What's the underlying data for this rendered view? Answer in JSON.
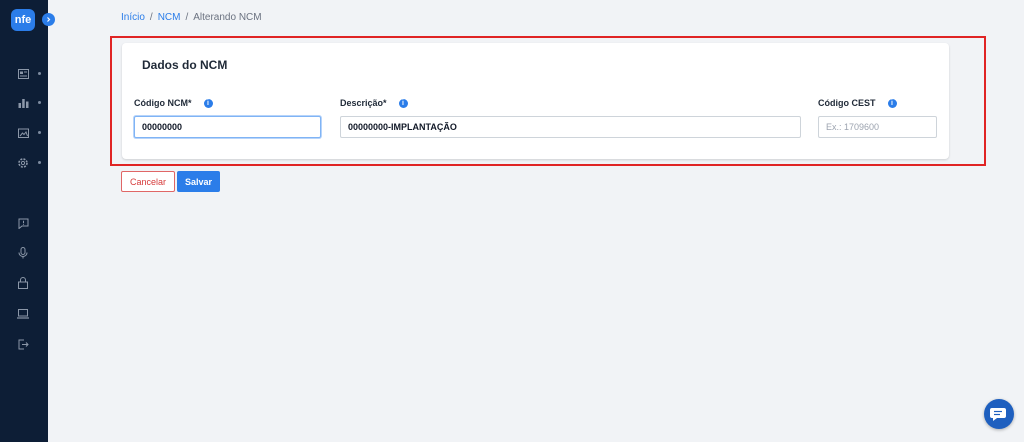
{
  "app": {
    "logo_text": "nfe"
  },
  "sidebar": {
    "items": [
      {
        "icon": "newspaper-icon"
      },
      {
        "icon": "bar-chart-icon"
      },
      {
        "icon": "folder-image-icon"
      },
      {
        "icon": "gear-icon"
      },
      {
        "icon": "feedback-icon"
      },
      {
        "icon": "microphone-icon"
      },
      {
        "icon": "lock-icon"
      },
      {
        "icon": "laptop-icon"
      },
      {
        "icon": "logout-icon"
      }
    ]
  },
  "breadcrumb": {
    "home": "Início",
    "sep1": "/",
    "section": "NCM",
    "sep2": "/",
    "current": "Alterando NCM"
  },
  "form": {
    "title": "Dados do NCM",
    "ncm_code": {
      "label": "Código NCM*",
      "value": "00000000",
      "info": "i"
    },
    "description": {
      "label": "Descrição*",
      "value": "00000000-IMPLANTAÇÃO",
      "info": "i"
    },
    "cest_code": {
      "label": "Código CEST",
      "value": "",
      "placeholder": "Ex.: 1709600",
      "info": "i"
    }
  },
  "actions": {
    "cancel_label": "Cancelar",
    "save_label": "Salvar"
  },
  "colors": {
    "accent": "#2b7de9",
    "sidebar": "#0d1e36",
    "highlight": "#e02424",
    "danger": "#d63b3b"
  }
}
